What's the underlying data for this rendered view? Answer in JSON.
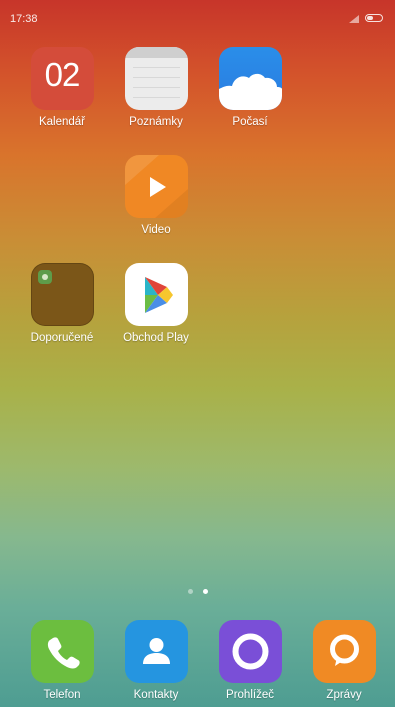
{
  "status_bar": {
    "time": "17:38",
    "icons": [
      "signal-icon",
      "battery-icon"
    ]
  },
  "home": {
    "apps": [
      {
        "label": "Kalendář",
        "icon": "calendar-icon",
        "badge_text": "02",
        "color": "#d44c3a"
      },
      {
        "label": "Poznámky",
        "icon": "notes-icon",
        "color": "#ececec"
      },
      {
        "label": "Počasí",
        "icon": "weather-icon",
        "color": "#2a8ee9"
      },
      {
        "label": "Video",
        "icon": "video-icon",
        "color": "#f08824"
      },
      {
        "label": "Doporučené",
        "icon": "folder-icon",
        "color": "#7b5618"
      },
      {
        "label": "Obchod Play",
        "icon": "play-store-icon",
        "color": "#ffffff"
      }
    ],
    "pages": {
      "count": 2,
      "current": 2
    }
  },
  "dock": {
    "apps": [
      {
        "label": "Telefon",
        "icon": "phone-icon",
        "color": "#6cbe3f"
      },
      {
        "label": "Kontakty",
        "icon": "contacts-icon",
        "color": "#2595e0"
      },
      {
        "label": "Prohlížeč",
        "icon": "browser-icon",
        "color": "#7a4fd7"
      },
      {
        "label": "Zprávy",
        "icon": "messages-icon",
        "color": "#f08a24"
      }
    ]
  }
}
